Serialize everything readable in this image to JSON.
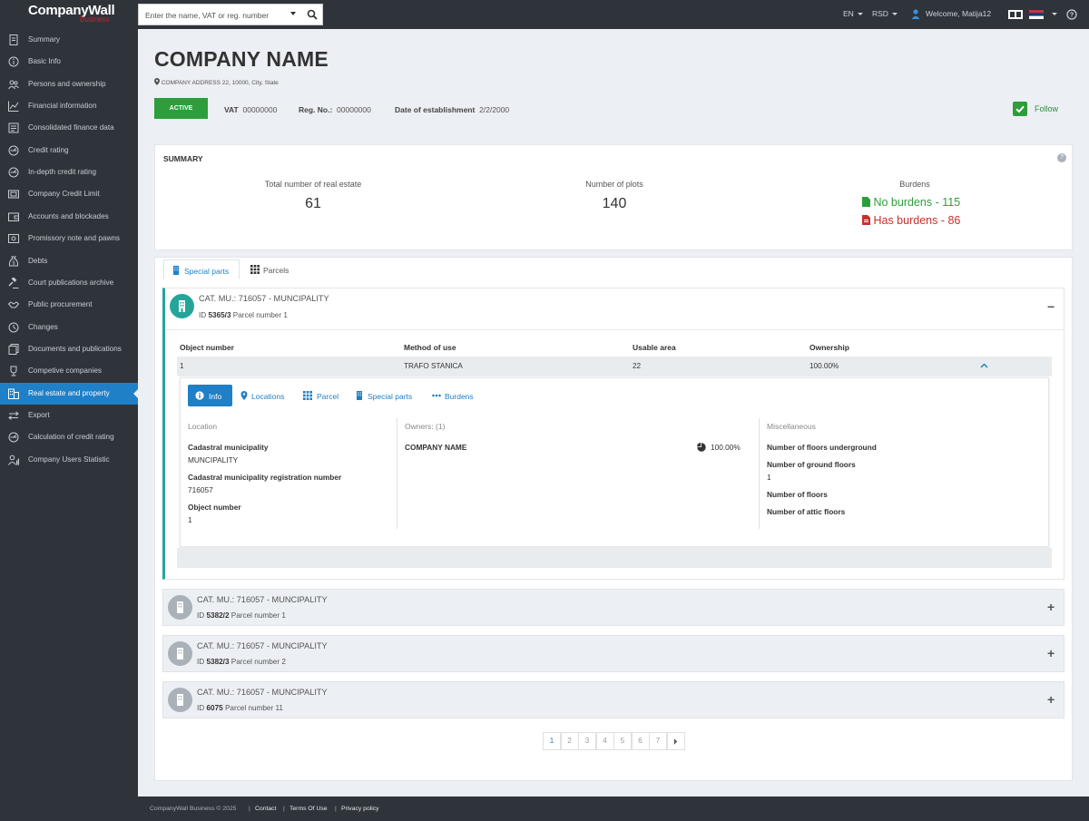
{
  "topbar": {
    "logo_main": "CompanyWall",
    "logo_sub": "Business",
    "search_placeholder": "Enter the name, VAT or reg. number",
    "language": "EN",
    "currency": "RSD",
    "welcome": "Welcome, Matija12"
  },
  "sidebar": {
    "items": [
      {
        "label": "Summary",
        "icon": "document-icon"
      },
      {
        "label": "Basic Info",
        "icon": "info-icon"
      },
      {
        "label": "Persons and ownership",
        "icon": "people-icon"
      },
      {
        "label": "Financial information",
        "icon": "chart-line-icon"
      },
      {
        "label": "Consolidated finance data",
        "icon": "ledger-icon"
      },
      {
        "label": "Credit rating",
        "icon": "gauge-icon"
      },
      {
        "label": "In-depth credit rating",
        "icon": "gauge-icon"
      },
      {
        "label": "Company Credit Limit",
        "icon": "card-icon"
      },
      {
        "label": "Accounts and blockades",
        "icon": "wallet-icon"
      },
      {
        "label": "Promissory note and pawns",
        "icon": "note-icon"
      },
      {
        "label": "Debts",
        "icon": "money-bag-icon"
      },
      {
        "label": "Court publications archive",
        "icon": "gavel-icon"
      },
      {
        "label": "Public procurement",
        "icon": "handshake-icon"
      },
      {
        "label": "Changes",
        "icon": "history-icon"
      },
      {
        "label": "Documents and publications",
        "icon": "documents-icon"
      },
      {
        "label": "Competive companies",
        "icon": "trophy-icon"
      },
      {
        "label": "Real estate and property",
        "icon": "building-icon"
      },
      {
        "label": "Export",
        "icon": "exchange-icon"
      },
      {
        "label": "Calculation of credit rating",
        "icon": "gauge-icon"
      },
      {
        "label": "Company Users Statistic",
        "icon": "user-stats-icon"
      }
    ],
    "active_index": 16
  },
  "company": {
    "name": "COMPANY NAME",
    "address": "COMPANY ADDRESS 22, 10000, City, State",
    "status": "ACTIVE",
    "vat_label": "VAT",
    "vat": "00000000",
    "reg_label": "Reg. No.:",
    "reg": "00000000",
    "est_label": "Date of establishment",
    "est": "2/2/2000",
    "follow": "Follow"
  },
  "summary": {
    "title": "SUMMARY",
    "total_label": "Total number of real estate",
    "total": "61",
    "plots_label": "Number of plots",
    "plots": "140",
    "burdens_label": "Burdens",
    "no_burdens": "No burdens - 115",
    "has_burdens": "Has burdens - 86"
  },
  "tabs": {
    "special_parts": "Special parts",
    "parcels": "Parcels"
  },
  "accordions": [
    {
      "title": "CAT. MU.: 716057 - MUNCIPALITY",
      "id_label": "ID",
      "id": "5365/3",
      "parcel": "Parcel number 1"
    },
    {
      "title": "CAT. MU.: 716057 - MUNCIPALITY",
      "id_label": "ID",
      "id": "5382/2",
      "parcel": "Parcel number 1"
    },
    {
      "title": "CAT. MU.: 716057 - MUNCIPALITY",
      "id_label": "ID",
      "id": "5382/3",
      "parcel": "Parcel number 2"
    },
    {
      "title": "CAT. MU.: 716057 - MUNCIPALITY",
      "id_label": "ID",
      "id": "6075",
      "parcel": "Parcel number 11"
    }
  ],
  "table": {
    "headers": [
      "Object number",
      "Method of use",
      "Usable area",
      "Ownership"
    ],
    "row": [
      "1",
      "TRAFO STANICA",
      "22",
      "100.00%"
    ]
  },
  "detail": {
    "tabs": [
      "Info",
      "Locations",
      "Parcel",
      "Special parts",
      "Burdens"
    ],
    "location_h": "Location",
    "cad_mun_label": "Cadastral municipality",
    "cad_mun": "MUNCIPALITY",
    "cad_reg_label": "Cadastral municipality registration number",
    "cad_reg": "716057",
    "obj_label": "Object number",
    "obj": "1",
    "owners_h": "Owners: (1)",
    "owner_name": "COMPANY NAME",
    "owner_pct": "100.00%",
    "misc_h": "Miscellaneous",
    "floors_under": "Number of floors underground",
    "ground_floors": "Number of ground floors",
    "ground_floors_val": "1",
    "floors": "Number of floors",
    "attic": "Number of attic floors"
  },
  "pagination": {
    "pages": [
      "1",
      "2",
      "3",
      "4",
      "5",
      "6",
      "7"
    ],
    "current": "1"
  },
  "footer": {
    "copyright": "CompanyWall Business © 2025",
    "contact": "Contact",
    "terms": "Terms Of Use",
    "privacy": "Privacy policy"
  },
  "colors": {
    "accent": "#1f7fc7",
    "green": "#2e9d3b",
    "red": "#c9302c",
    "teal": "#25a59a",
    "dark": "#2f343b"
  }
}
